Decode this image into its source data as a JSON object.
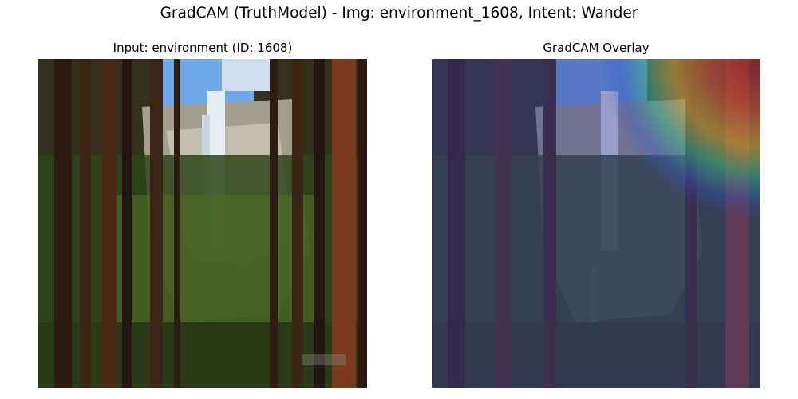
{
  "figure": {
    "title": "GradCAM (TruthModel) - Img: environment_1608, Intent: Wander"
  },
  "panels": {
    "input": {
      "title": "Input: environment (ID: 1608)"
    },
    "overlay": {
      "title": "GradCAM Overlay"
    }
  },
  "scene": {
    "description_colors": {
      "sky": "#6fa8e8",
      "cliff": "#b8b2a2",
      "waterfall": "#e8eef2",
      "foliage": "#2f4a1c",
      "trunk_dark": "#2a1a10",
      "trunk_red": "#7a3a1e"
    }
  },
  "overlay": {
    "tint": "#3b3b9a",
    "heat_colors": [
      "#b01818",
      "#e0501a",
      "#f0c020",
      "#40c080",
      "#3060d0"
    ]
  }
}
